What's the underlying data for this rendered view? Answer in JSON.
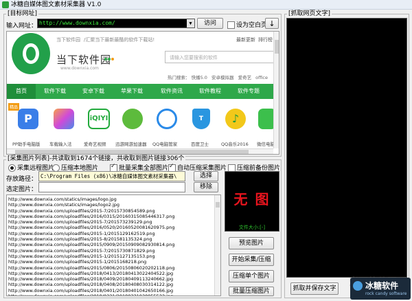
{
  "window": {
    "title": "冰糖自媒体图文素材采集器 V1.0"
  },
  "target_group": {
    "label": "[目标网址]",
    "url_label": "输入网址：",
    "url_value": "http://www.downxia.com/",
    "visit_button": "访问",
    "homepage_checkbox": "设为空白页",
    "homepage_checked": false,
    "download_icon": "down-arrow-icon"
  },
  "webpage": {
    "top_link_1": "当下软件园",
    "top_link_2": "/汇聚当下最新最酷的软件下载站!",
    "top_right": [
      "最新更新",
      "排行榜"
    ],
    "logo_text": "当下软件园",
    "logo_sub": "www.downxia.com",
    "search_placeholder": "请输入您要搜索的软件",
    "hot_label": "热门搜索：",
    "hot_items": [
      "快播5.0",
      "安卓模拟器",
      "爱奇艺",
      "office"
    ],
    "nav": [
      "首页",
      "软件下载",
      "安卓下载",
      "苹果下载",
      "软件资讯",
      "软件教程",
      "软件专题"
    ],
    "nav_color": "#2ea84a",
    "apps": [
      {
        "name": "PP助手电脑版",
        "color": "#3a7ee8",
        "icon": "pp-assistant-icon"
      },
      {
        "name": "车载输入法",
        "color": "#c44edc",
        "icon": "input-method-icon"
      },
      {
        "name": "爱奇艺视频",
        "color": "#22aa3c",
        "icon": "iqiyi-icon"
      },
      {
        "name": "迅游网游加速器",
        "color": "#2b8a3e",
        "icon": "xunyou-icon"
      },
      {
        "name": "QQ电脑管家",
        "color": "#2a8ae8",
        "icon": "qq-manager-icon"
      },
      {
        "name": "百度卫士",
        "color": "#2a96e0",
        "icon": "baidu-guard-icon"
      },
      {
        "name": "QQ音乐2016",
        "color": "#f2c81a",
        "icon": "qq-music-icon"
      },
      {
        "name": "微信电脑版",
        "color": "#3cbf4c",
        "icon": "wechat-icon"
      }
    ],
    "badge": "精品"
  },
  "capture_text_group": {
    "label": "[抓取网页文字]",
    "button": "抓取并保存文字"
  },
  "image_group": {
    "label": "[采集图片列表]-共读取到1674个链接，共收取到图片链接306个",
    "radio_remote": "采集远程图片",
    "radio_local": "压缩本地图片",
    "remote_selected": true,
    "check_batch": "批量采集全部图片",
    "check_batch_on": true,
    "check_auto": "自动压缩采集图片",
    "check_auto_on": true,
    "check_before": "压缩前备份图片",
    "check_before_on": false,
    "save_path_label": "存放路径：",
    "save_path_value": "C:\\Program Files (x86)\\冰糖自媒体图文素材采集器\\",
    "select_button": "选择",
    "selected_label": "选定图片：",
    "selected_value": "",
    "remove_button": "移除",
    "preview_text": "无 图",
    "file_size": "文件大小:[-]",
    "btn_preview": "预览图片",
    "btn_start": "开始采集/压缩",
    "btn_compress_one": "压缩单个图片",
    "btn_batch_compress": "批量压缩图片",
    "links": [
      "http://www.downxia.com/statics/images/logo.jpg",
      "http://www.downxia.com/statics/images/logo2.jpg",
      "http://www.downxia.com/uploadfiles/2015-7/2015730854589.png",
      "http://www.downxia.com/uploadfiles/2016/0315/20160315085446317.png",
      "http://www.downxia.com/uploadfiles/2015-7/201573239129.png",
      "http://www.downxia.com/uploadfiles/2016/0520/20160520081620975.png",
      "http://www.downxia.com/uploadfiles/2015-1/2015129162519.png",
      "http://www.downxia.com/uploadfiles/2015-8/201581135324.png",
      "http://www.downxia.com/uploadfiles/2015/0909/20150909082930814.png",
      "http://www.downxia.com/uploadfiles/2015-7/2015730871829.png",
      "http://www.downxia.com/uploadfiles/2015-1/2015127135153.png",
      "http://www.downxia.com/uploadfiles/2015-1/2015168218.png",
      "http://www.downxia.com/uploadfiles/2015/0806/20150806020202118.png",
      "http://www.downxia.com/uploadfiles/2018/0413/20180413022404522.jpg",
      "http://www.downxia.com/uploadfiles/2018/0409/20180409113240662.jpg",
      "http://www.downxia.com/uploadfiles/2018/0408/20180408030314122.jpg",
      "http://www.downxia.com/uploadfiles/2018/0401/20180401042650166.jpg",
      "http://www.downxia.com/uploadfiles/2018/0331/20180331030955533.jpg",
      "http://www.downxia.com/uploadfiles/2018/0420/20180420102348368.jpg"
    ]
  },
  "watermark": {
    "brand": "冰糖软件",
    "sub": "rock candy software",
    "overlay": "当下软件园"
  }
}
